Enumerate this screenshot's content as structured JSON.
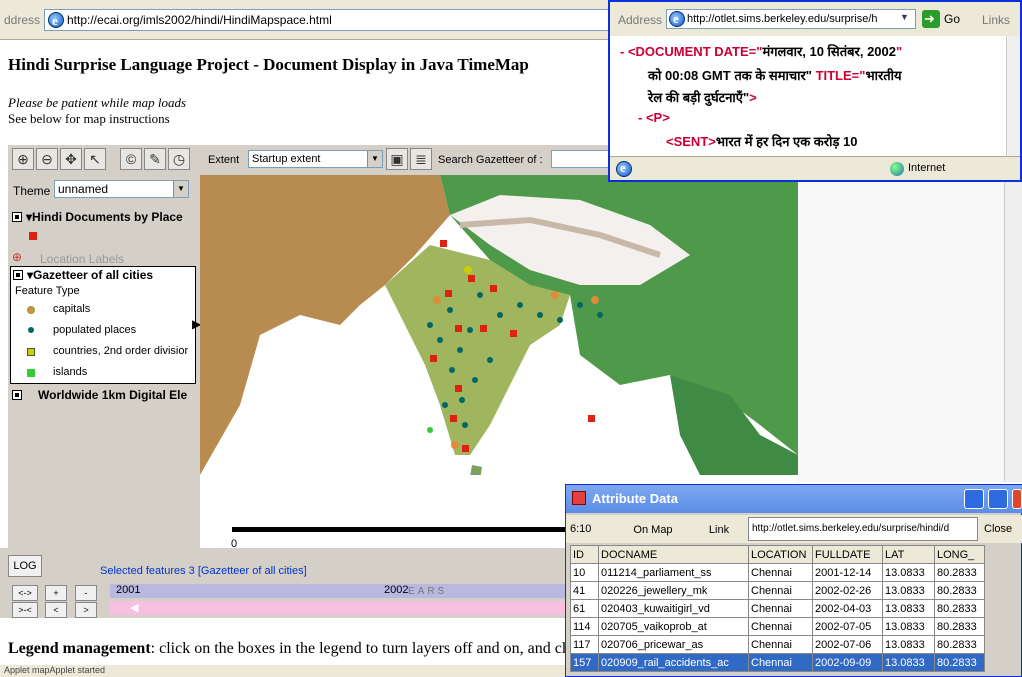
{
  "browser1": {
    "address_label": "ddress",
    "url": "http://ecai.org/imls2002/hindi/HindiMapspace.html"
  },
  "page": {
    "title": "Hindi Surprise Language Project - Document Display in Java TimeMap",
    "patient": "Please be patient while map loads",
    "instructions": "See below for map instructions",
    "legend_bold": "Legend management",
    "legend_text": ": click on the boxes in the legend to turn layers off and on, and cli",
    "status": "Applet mapApplet started"
  },
  "toolbar": {
    "extent_label": "Extent",
    "extent_value": "Startup extent",
    "gazetteer_label": "Search Gazetteer of :"
  },
  "layers": {
    "theme_label": "Theme",
    "theme_value": "unnamed",
    "hindi_docs": "Hindi Documents by Place",
    "location_labels": "Location Labels",
    "gazetteer": "Gazetteer of all cities",
    "feature_type": "Feature Type",
    "features": [
      "capitals",
      "populated places",
      "countries, 2nd order divisior",
      "islands"
    ],
    "worldwide": "Worldwide 1km Digital Ele"
  },
  "map": {
    "scale_zero": "0"
  },
  "controls": {
    "log": "LOG",
    "selected": "Selected features 3 [Gazetteer of all cities]",
    "year1": "2001",
    "year2": "2002",
    "years": "EARS",
    "b1": "<->",
    "b2": "+",
    "b3": "-",
    "b4": ">-<",
    "b5": "<",
    "b6": ">"
  },
  "browser2": {
    "address_label": "Address",
    "url": "http://otlet.sims.berkeley.edu/surprise/h",
    "go": "Go",
    "links": "Links",
    "line1a": "- <DOCUMENT DATE=\"",
    "line1b": "मंगलवार, 10 सितंबर, 2002",
    "line2": "को 00:08 GMT तक के समाचार\"",
    "line2b": " TITLE=\"",
    "line2c": "भारतीय",
    "line3": "रेल की बड़ी दुर्घटनाएँ\"",
    "line3b": ">",
    "line4": "- <P>",
    "line5a": "<SENT>",
    "line5b": "भारत में हर दिन एक करोड़ 10",
    "internet": "Internet"
  },
  "attribute": {
    "title": "Attribute Data",
    "count": "6:10",
    "on_map": "On Map",
    "link": "Link",
    "url": "http://otlet.sims.berkeley.edu/surprise/hindi/d",
    "close": "Close",
    "headers": [
      "ID",
      "DOCNAME",
      "LOCATION",
      "FULLDATE",
      "LAT",
      "LONG_"
    ],
    "rows": [
      [
        "10",
        "011214_parliament_ss",
        "Chennai",
        "2001-12-14",
        "13.0833",
        "80.2833"
      ],
      [
        "41",
        "020226_jewellery_mk",
        "Chennai",
        "2002-02-26",
        "13.0833",
        "80.2833"
      ],
      [
        "61",
        "020403_kuwaitigirl_vd",
        "Chennai",
        "2002-04-03",
        "13.0833",
        "80.2833"
      ],
      [
        "114",
        "020705_vaikoprob_at",
        "Chennai",
        "2002-07-05",
        "13.0833",
        "80.2833"
      ],
      [
        "117",
        "020706_pricewar_as",
        "Chennai",
        "2002-07-06",
        "13.0833",
        "80.2833"
      ],
      [
        "157",
        "020909_rail_accidents_ac",
        "Chennai",
        "2002-09-09",
        "13.0833",
        "80.2833"
      ]
    ]
  },
  "colors": {
    "capitals": "#e08a3c",
    "populated": "#006666",
    "countries": "#cccc00",
    "islands": "#33cc33",
    "docs": "#dd2211"
  }
}
